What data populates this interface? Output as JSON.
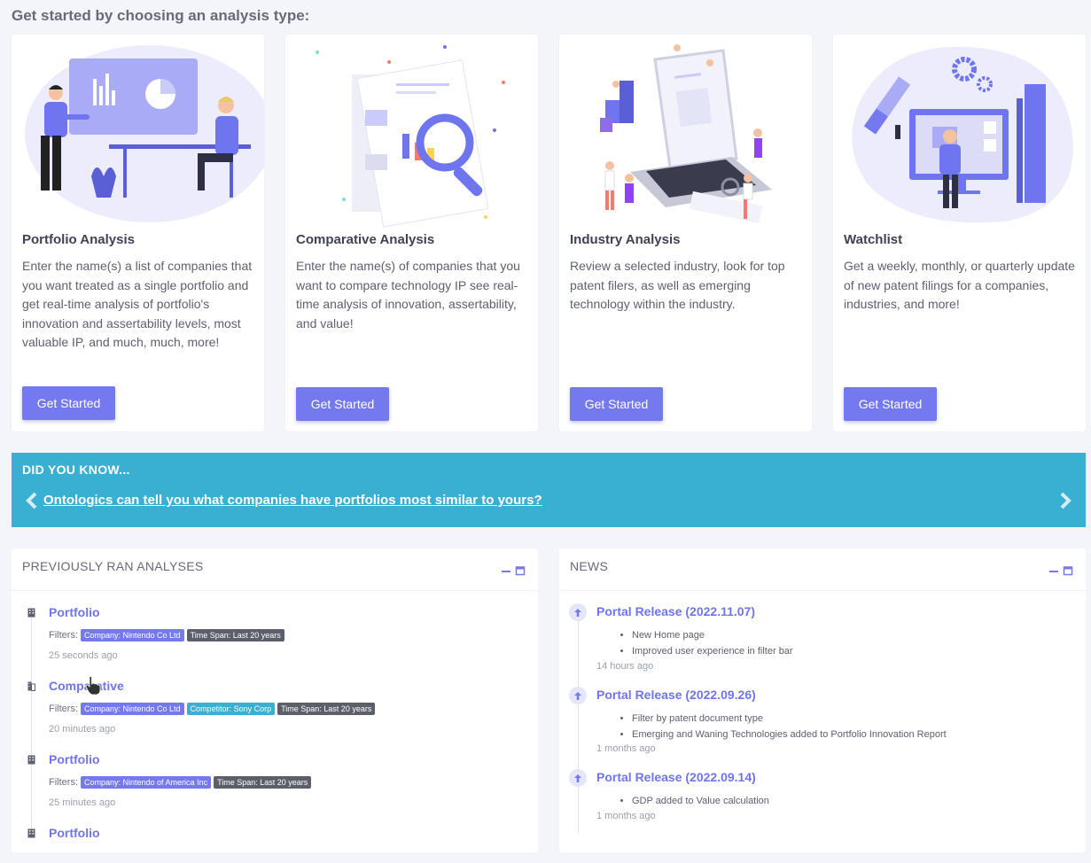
{
  "heading": "Get started by choosing an analysis type:",
  "cards": [
    {
      "title": "Portfolio Analysis",
      "description": "Enter the name(s) a list of companies that you want treated as a single portfolio and get real-time analysis of portfolio's innovation and assertability levels, most valuable IP, and much, much, more!",
      "button": "Get Started"
    },
    {
      "title": "Comparative Analysis",
      "description": "Enter the name(s) of companies that you want to compare technology IP see real-time analysis of innovation, assertability, and value!",
      "button": "Get Started"
    },
    {
      "title": "Industry Analysis",
      "description": "Review a selected industry, look for top patent filers, as well as emerging technology within the industry.",
      "button": "Get Started"
    },
    {
      "title": "Watchlist",
      "description": "Get a weekly, monthly, or quarterly update of new patent filings for a companies, industries, and more!",
      "button": "Get Started"
    }
  ],
  "banner": {
    "title": "DID YOU KNOW...",
    "link": "Ontologics can tell you what companies have portfolios most similar to yours?"
  },
  "previous": {
    "title": "PREVIOUSLY RAN ANALYSES",
    "filters_label": "Filters:",
    "items": [
      {
        "name": "Portfolio",
        "badges": [
          "Company: Nintendo Co Ltd",
          "Time Span: Last 20 years"
        ],
        "time": "25 seconds ago"
      },
      {
        "name": "Comparative",
        "badges": [
          "Company: Nintendo Co Ltd",
          "Competitor: Sony Corp",
          "Time Span: Last 20 years"
        ],
        "time": "20 minutes ago"
      },
      {
        "name": "Portfolio",
        "badges": [
          "Company: Nintendo of America Inc",
          "Time Span: Last 20 years"
        ],
        "time": "25 minutes ago"
      },
      {
        "name": "Portfolio"
      }
    ]
  },
  "news": {
    "title": "NEWS",
    "items": [
      {
        "title": "Portal Release (2022.11.07)",
        "bullets": [
          "New Home page",
          "Improved user experience in filter bar"
        ],
        "time": "14 hours ago"
      },
      {
        "title": "Portal Release (2022.09.26)",
        "bullets": [
          "Filter by patent document type",
          "Emerging and Waning Technologies added to Portfolio Innovation Report"
        ],
        "time": "1 months ago"
      },
      {
        "title": "Portal Release (2022.09.14)",
        "bullets": [
          "GDP added to Value calculation"
        ],
        "time": "1 months ago"
      }
    ]
  },
  "colors": {
    "accent": "#7579f0",
    "banner": "#39afd1",
    "background": "#f4f5fa"
  }
}
